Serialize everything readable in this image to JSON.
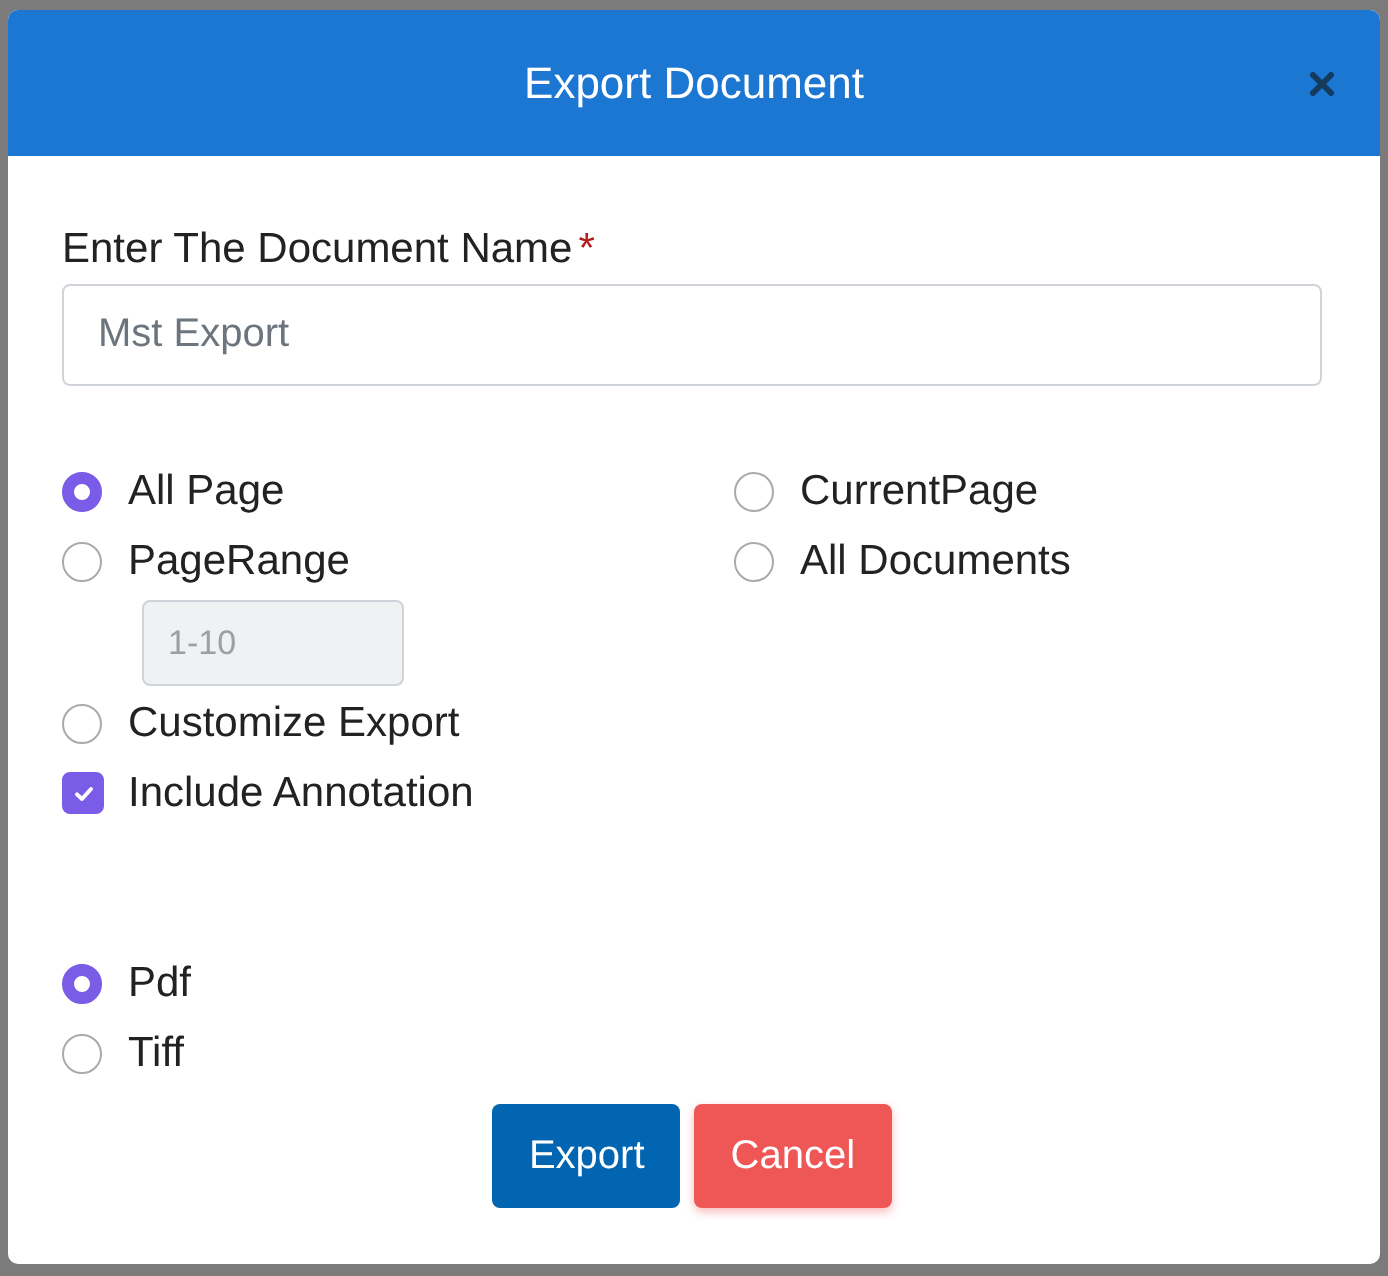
{
  "dialog": {
    "title": "Export Document",
    "name_field": {
      "label": "Enter The Document Name",
      "required_mark": "*",
      "value": "Mst Export"
    },
    "options": [
      {
        "kind": "radio",
        "label": "All Page",
        "selected": true
      },
      {
        "kind": "radio",
        "label": "CurrentPage",
        "selected": false
      },
      {
        "kind": "radio",
        "label": "PageRange",
        "selected": false
      },
      {
        "kind": "radio",
        "label": "All Documents",
        "selected": false
      },
      {
        "kind": "range",
        "value": "1-10",
        "disabled": true
      },
      {
        "kind": "radio",
        "label": "Customize Export",
        "selected": false
      },
      {
        "kind": "checkbox",
        "label": "Include Annotation",
        "checked": true
      }
    ],
    "formats": [
      {
        "label": "Pdf",
        "selected": true
      },
      {
        "label": "Tiff",
        "selected": false
      }
    ],
    "buttons": [
      {
        "label": "Export",
        "kind": "primary"
      },
      {
        "label": "Cancel",
        "kind": "danger"
      }
    ]
  }
}
